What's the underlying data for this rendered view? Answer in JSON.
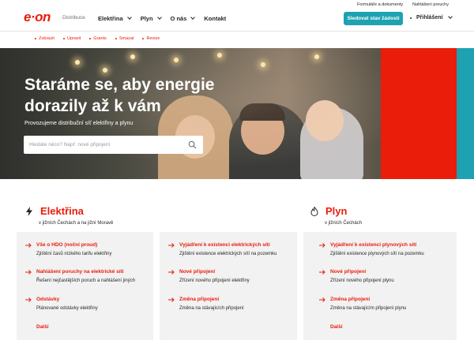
{
  "header": {
    "logo": "e·on",
    "logo_sub": "Distribuce",
    "nav": [
      {
        "label": "Elektřina"
      },
      {
        "label": "Plyn"
      },
      {
        "label": "O nás"
      },
      {
        "label": "Kontakt"
      }
    ],
    "top_links": [
      "Formuláře a dokumenty",
      "Nahlášení poruchy"
    ],
    "track_button": "Sledovat stav žádostí",
    "login": "Přihlášení"
  },
  "subnav": [
    "Zobrazit",
    "Upravit",
    "Grants",
    "Smazat",
    "Revize"
  ],
  "hero": {
    "title": "Staráme se, aby energie dorazily až k vám",
    "subtitle": "Provozujeme distribuční síť elektřiny a plynu",
    "search_placeholder": "Hledáte něco? Např. nové připojení",
    "search_value": ""
  },
  "elektrina": {
    "title": "Elektřina",
    "subtitle": "v jižních Čechách a na jižní Moravě",
    "col1": [
      {
        "link": "Vše o HDO (noční proud)",
        "desc": "Zjištění časů nízkého tarifu elektřiny"
      },
      {
        "link": "Nahlášení poruchy na elektrické síti",
        "desc": "Řešení nejčastějších poruch a nahlášení jiných"
      },
      {
        "link": "Odstávky",
        "desc": "Plánované odstávky elektřiny"
      }
    ],
    "col2": [
      {
        "link": "Vyjádření k existenci elektrických sítí",
        "desc": "Zjištění existence elektrických sítí na pozemku"
      },
      {
        "link": "Nové připojení",
        "desc": "Zřízení nového připojení elektřiny"
      },
      {
        "link": "Změna připojení",
        "desc": "Změna na stávajících připojení"
      }
    ],
    "more": "Další"
  },
  "plyn": {
    "title": "Plyn",
    "subtitle": "v jižních Čechách",
    "col1": [
      {
        "link": "Vyjádření k existenci plynových sítí",
        "desc": "Zjištění existence plynových sítí na pozemku"
      },
      {
        "link": "Nové připojení",
        "desc": "Zřízení nového připojení plynu"
      },
      {
        "link": "Změna připojení",
        "desc": "Změna na stávajícím připojení plynu"
      }
    ],
    "more": "Další"
  },
  "colors": {
    "brand_red": "#ea1c0a",
    "brand_teal": "#1ea2b1"
  }
}
